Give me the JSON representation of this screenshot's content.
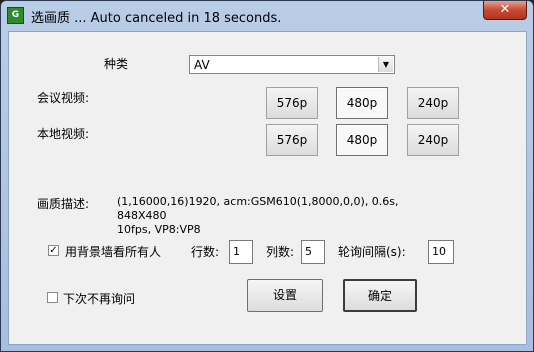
{
  "window": {
    "title": "选画质 ... Auto canceled in 18 seconds.",
    "icon": "app-icon",
    "close_glyph": "✕"
  },
  "form": {
    "type_label": "种类",
    "type_value": "AV",
    "meeting_label": "会议视频:",
    "local_label": "本地视频:",
    "meeting_options": [
      "576p",
      "480p",
      "240p"
    ],
    "local_options": [
      "576p",
      "480p",
      "240p"
    ],
    "meeting_selected": "480p",
    "local_selected": "480p",
    "desc_label": "画质描述:",
    "desc_line1": "(1,16000,16)1920, acm:GSM610(1,8000,0,0), 0.6s, 848X480",
    "desc_line2": "10fps, VP8:VP8",
    "bgwall_label": "用背景墙看所有人",
    "bgwall_checked": true,
    "rows_label": "行数:",
    "rows_value": "1",
    "cols_label": "列数:",
    "cols_value": "5",
    "interval_label": "轮询间隔(s):",
    "interval_value": "10",
    "noask_label": "下次不再询问",
    "noask_checked": false
  },
  "buttons": {
    "settings": "设置",
    "ok": "确定"
  }
}
